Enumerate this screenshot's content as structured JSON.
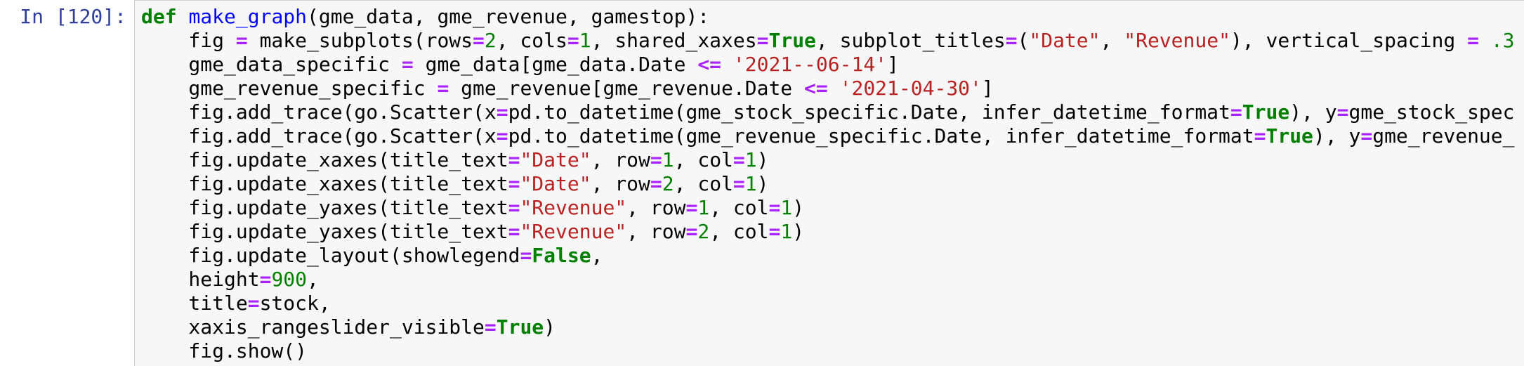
{
  "prompt": "In [120]:",
  "code_lines": [
    [
      {
        "c": "kw",
        "t": "def"
      },
      {
        "c": "",
        "t": " "
      },
      {
        "c": "fn",
        "t": "make_graph"
      },
      {
        "c": "",
        "t": "(gme_data, gme_revenue, gamestop):"
      }
    ],
    [
      {
        "c": "",
        "t": "    fig "
      },
      {
        "c": "op",
        "t": "="
      },
      {
        "c": "",
        "t": " make_subplots(rows"
      },
      {
        "c": "op",
        "t": "="
      },
      {
        "c": "num",
        "t": "2"
      },
      {
        "c": "",
        "t": ", cols"
      },
      {
        "c": "op",
        "t": "="
      },
      {
        "c": "num",
        "t": "1"
      },
      {
        "c": "",
        "t": ", shared_xaxes"
      },
      {
        "c": "op",
        "t": "="
      },
      {
        "c": "kw",
        "t": "True"
      },
      {
        "c": "",
        "t": ", subplot_titles"
      },
      {
        "c": "op",
        "t": "="
      },
      {
        "c": "",
        "t": "("
      },
      {
        "c": "str",
        "t": "\"Date\""
      },
      {
        "c": "",
        "t": ", "
      },
      {
        "c": "str",
        "t": "\"Revenue\""
      },
      {
        "c": "",
        "t": "), vertical_spacing "
      },
      {
        "c": "op",
        "t": "="
      },
      {
        "c": "",
        "t": " "
      },
      {
        "c": "num",
        "t": ".3"
      }
    ],
    [
      {
        "c": "",
        "t": "    gme_data_specific "
      },
      {
        "c": "op",
        "t": "="
      },
      {
        "c": "",
        "t": " gme_data[gme_data.Date "
      },
      {
        "c": "op",
        "t": "<="
      },
      {
        "c": "",
        "t": " "
      },
      {
        "c": "str",
        "t": "'2021--06-14'"
      },
      {
        "c": "",
        "t": "]"
      }
    ],
    [
      {
        "c": "",
        "t": "    gme_revenue_specific "
      },
      {
        "c": "op",
        "t": "="
      },
      {
        "c": "",
        "t": " gme_revenue[gme_revenue.Date "
      },
      {
        "c": "op",
        "t": "<="
      },
      {
        "c": "",
        "t": " "
      },
      {
        "c": "str",
        "t": "'2021-04-30'"
      },
      {
        "c": "",
        "t": "]"
      }
    ],
    [
      {
        "c": "",
        "t": "    fig.add_trace(go.Scatter(x"
      },
      {
        "c": "op",
        "t": "="
      },
      {
        "c": "",
        "t": "pd.to_datetime(gme_stock_specific.Date, infer_datetime_format"
      },
      {
        "c": "op",
        "t": "="
      },
      {
        "c": "kw",
        "t": "True"
      },
      {
        "c": "",
        "t": "), y"
      },
      {
        "c": "op",
        "t": "="
      },
      {
        "c": "",
        "t": "gme_stock_spec"
      }
    ],
    [
      {
        "c": "",
        "t": "    fig.add_trace(go.Scatter(x"
      },
      {
        "c": "op",
        "t": "="
      },
      {
        "c": "",
        "t": "pd.to_datetime(gme_revenue_specific.Date, infer_datetime_format"
      },
      {
        "c": "op",
        "t": "="
      },
      {
        "c": "kw",
        "t": "True"
      },
      {
        "c": "",
        "t": "), y"
      },
      {
        "c": "op",
        "t": "="
      },
      {
        "c": "",
        "t": "gme_revenue_"
      }
    ],
    [
      {
        "c": "",
        "t": "    fig.update_xaxes(title_text"
      },
      {
        "c": "op",
        "t": "="
      },
      {
        "c": "str",
        "t": "\"Date\""
      },
      {
        "c": "",
        "t": ", row"
      },
      {
        "c": "op",
        "t": "="
      },
      {
        "c": "num",
        "t": "1"
      },
      {
        "c": "",
        "t": ", col"
      },
      {
        "c": "op",
        "t": "="
      },
      {
        "c": "num",
        "t": "1"
      },
      {
        "c": "",
        "t": ")"
      }
    ],
    [
      {
        "c": "",
        "t": "    fig.update_xaxes(title_text"
      },
      {
        "c": "op",
        "t": "="
      },
      {
        "c": "str",
        "t": "\"Date\""
      },
      {
        "c": "",
        "t": ", row"
      },
      {
        "c": "op",
        "t": "="
      },
      {
        "c": "num",
        "t": "2"
      },
      {
        "c": "",
        "t": ", col"
      },
      {
        "c": "op",
        "t": "="
      },
      {
        "c": "num",
        "t": "1"
      },
      {
        "c": "",
        "t": ")"
      }
    ],
    [
      {
        "c": "",
        "t": "    fig.update_yaxes(title_text"
      },
      {
        "c": "op",
        "t": "="
      },
      {
        "c": "str",
        "t": "\"Revenue\""
      },
      {
        "c": "",
        "t": ", row"
      },
      {
        "c": "op",
        "t": "="
      },
      {
        "c": "num",
        "t": "1"
      },
      {
        "c": "",
        "t": ", col"
      },
      {
        "c": "op",
        "t": "="
      },
      {
        "c": "num",
        "t": "1"
      },
      {
        "c": "",
        "t": ")"
      }
    ],
    [
      {
        "c": "",
        "t": "    fig.update_yaxes(title_text"
      },
      {
        "c": "op",
        "t": "="
      },
      {
        "c": "str",
        "t": "\"Revenue\""
      },
      {
        "c": "",
        "t": ", row"
      },
      {
        "c": "op",
        "t": "="
      },
      {
        "c": "num",
        "t": "2"
      },
      {
        "c": "",
        "t": ", col"
      },
      {
        "c": "op",
        "t": "="
      },
      {
        "c": "num",
        "t": "1"
      },
      {
        "c": "",
        "t": ")"
      }
    ],
    [
      {
        "c": "",
        "t": "    fig.update_layout(showlegend"
      },
      {
        "c": "op",
        "t": "="
      },
      {
        "c": "kw",
        "t": "False"
      },
      {
        "c": "",
        "t": ","
      }
    ],
    [
      {
        "c": "",
        "t": "    height"
      },
      {
        "c": "op",
        "t": "="
      },
      {
        "c": "num",
        "t": "900"
      },
      {
        "c": "",
        "t": ","
      }
    ],
    [
      {
        "c": "",
        "t": "    title"
      },
      {
        "c": "op",
        "t": "="
      },
      {
        "c": "",
        "t": "stock,"
      }
    ],
    [
      {
        "c": "",
        "t": "    xaxis_rangeslider_visible"
      },
      {
        "c": "op",
        "t": "="
      },
      {
        "c": "kw",
        "t": "True"
      },
      {
        "c": "",
        "t": ")"
      }
    ],
    [
      {
        "c": "",
        "t": "    fig.show()"
      }
    ]
  ]
}
